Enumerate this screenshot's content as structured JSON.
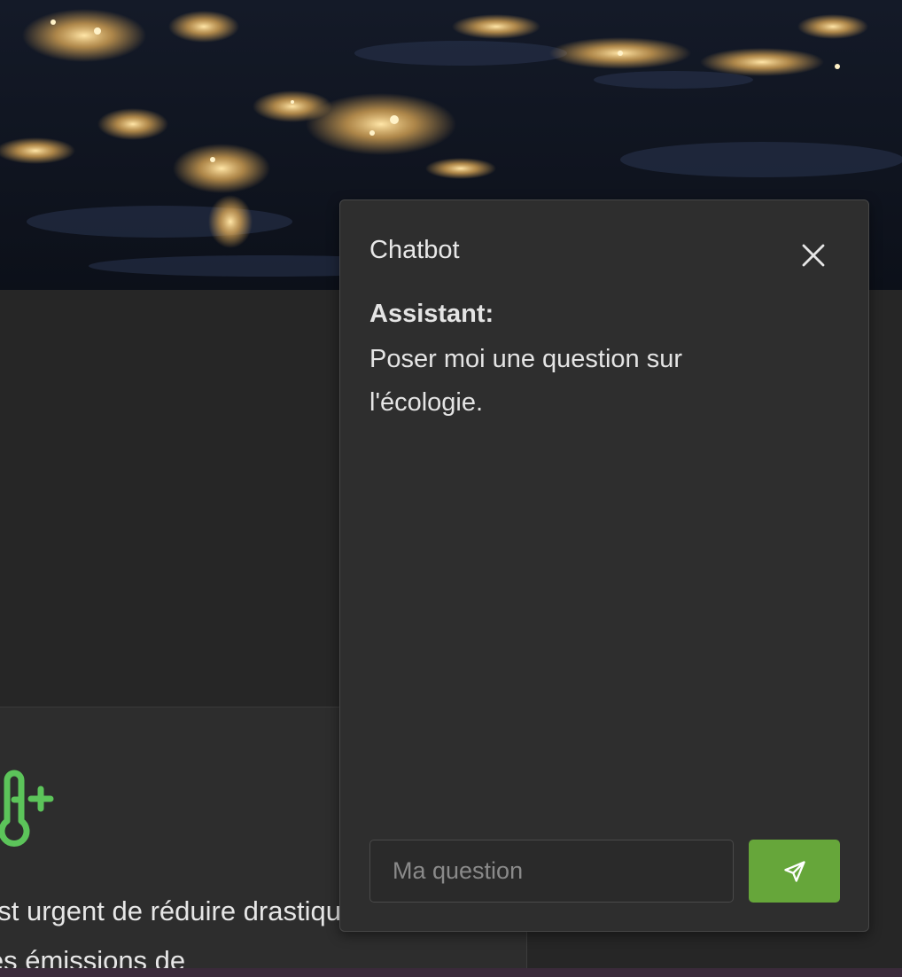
{
  "hero": {
    "image": "night-earth-city-lights"
  },
  "card": {
    "icon": "thermometer-plus-icon",
    "icon_color": "#5cc45a",
    "text": "est urgent de réduire drastiquement les émissions de"
  },
  "chatbot": {
    "title": "Chatbot",
    "close_icon": "close-icon",
    "messages": [
      {
        "role": "Assistant:",
        "text": "Poser moi une question sur l'écologie."
      }
    ],
    "input": {
      "value": "",
      "placeholder": "Ma question"
    },
    "send_icon": "send-icon",
    "send_color": "#66a63a"
  }
}
